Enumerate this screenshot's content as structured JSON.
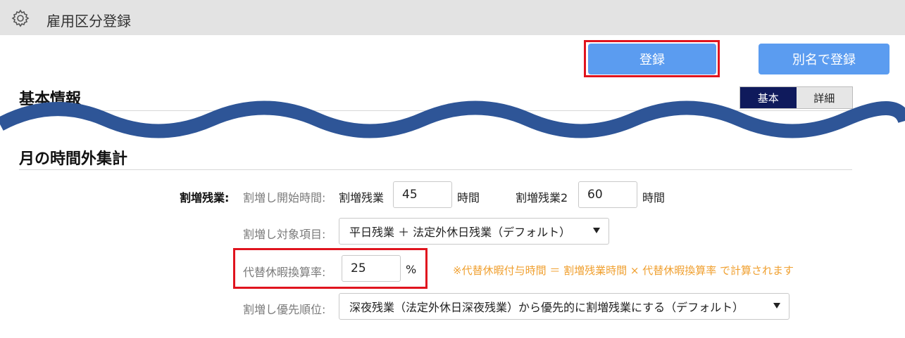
{
  "header": {
    "title": "雇用区分登録",
    "icon": "gear-icon"
  },
  "actions": {
    "register_label": "登録",
    "register_alias_label": "別名で登録"
  },
  "sections": {
    "basic_info": "基本情報",
    "monthly_overtime": "月の時間外集計"
  },
  "tabs": [
    {
      "label": "基本",
      "active": true
    },
    {
      "label": "詳細",
      "active": false
    }
  ],
  "overtime": {
    "label": "割増残業:",
    "start_time_label": "割増し開始時間:",
    "tier1_label": "割増残業",
    "tier1_value": "45",
    "tier1_unit": "時間",
    "tier2_label": "割増残業2",
    "tier2_value": "60",
    "tier2_unit": "時間"
  },
  "target_items": {
    "label": "割増し対象項目:",
    "selected": "平日残業 ＋ 法定外休日残業（デフォルト）"
  },
  "substitute_rate": {
    "label": "代替休暇換算率:",
    "value": "25",
    "unit": "%",
    "note": "※代替休暇付与時間 ＝ 割増残業時間 × 代替休暇換算率 で計算されます"
  },
  "priority": {
    "label": "割増し優先順位:",
    "selected": "深夜残業（法定外休日深夜残業）から優先的に割増残業にする（デフォルト）"
  },
  "colors": {
    "accent": "#5b9cf0",
    "highlight": "#e0141e",
    "note": "#f0a030",
    "tab_active": "#0f1a5c",
    "wave": "#2e5597"
  }
}
